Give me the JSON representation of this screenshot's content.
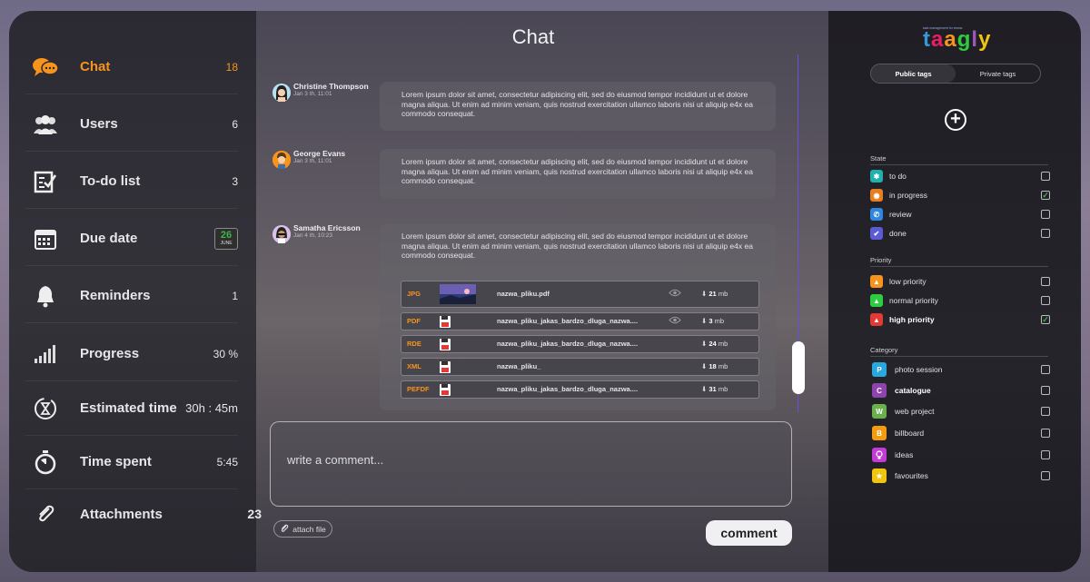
{
  "sidebar": {
    "items": [
      {
        "label": "Chat",
        "value": "18",
        "icon": "chat-bubbles-icon"
      },
      {
        "label": "Users",
        "value": "6",
        "icon": "users-icon"
      },
      {
        "label": "To-do list",
        "value": "3",
        "icon": "checklist-icon"
      },
      {
        "label": "Due date",
        "value": "",
        "icon": "calendar-icon"
      },
      {
        "label": "Reminders",
        "value": "1",
        "icon": "bell-icon"
      },
      {
        "label": "Progress",
        "value": "30 %",
        "icon": "bars-icon"
      },
      {
        "label": "Estimated time",
        "value": "30h : 45m",
        "icon": "hourglass-icon"
      },
      {
        "label": "Time spent",
        "value": "5:45",
        "icon": "stopwatch-icon"
      },
      {
        "label": "Attachments",
        "value": "23",
        "icon": "paperclip-icon"
      }
    ],
    "due_day": "26",
    "due_month": "JUNE"
  },
  "chat": {
    "title": "Chat",
    "messages": [
      {
        "author": "Christine Thompson",
        "date": "Jan 3 th, 11:01",
        "text": "Lorem ipsum dolor sit amet, consectetur adipiscing elit, sed do eiusmod tempor  incididunt ut et  dolore magna aliqua. Ut enim ad minim veniam, quis nostrud exercitation ullamco laboris nisi ut aliquip e4x ea commodo consequat."
      },
      {
        "author": "George Evans",
        "date": "Jan 3 th, 11:01",
        "text": "Lorem ipsum dolor sit amet, consectetur adipiscing elit, sed do eiusmod tempor  incididunt ut et  dolore magna aliqua. Ut enim ad minim veniam, quis nostrud exercitation ullamco laboris nisi ut aliquip e4x ea commodo consequat."
      },
      {
        "author": "Samatha Ericsson",
        "date": "Jan 4 th, 10:23",
        "text": "Lorem ipsum dolor sit amet, consectetur adipiscing elit, sed do eiusmod tempor  incididunt ut et  dolore magna aliqua. Ut enim ad minim veniam, quis nostrud exercitation ullamco laboris nisi ut aliquip e4x ea commodo consequat."
      }
    ],
    "files": [
      {
        "ext": "JPG",
        "name": "nazwa_pliku.pdf",
        "size": "21",
        "unit": "mb",
        "preview": true
      },
      {
        "ext": "PDF",
        "name": "nazwa_pliku_jakas_bardzo_dluga_nazwa....",
        "size": "3",
        "unit": "mb",
        "preview": true
      },
      {
        "ext": "RDE",
        "name": "nazwa_pliku_jakas_bardzo_dluga_nazwa....",
        "size": "24",
        "unit": "mb",
        "preview": false
      },
      {
        "ext": "XML",
        "name": "nazwa_pliku_",
        "size": "18",
        "unit": "mb",
        "preview": false
      },
      {
        "ext": "PEFDF",
        "name": "nazwa_pliku_jakas_bardzo_dluga_nazwa....",
        "size": "31",
        "unit": "mb",
        "preview": false
      }
    ],
    "comment_placeholder": "write a comment...",
    "attach_label": "attach file",
    "comment_button": "comment"
  },
  "right": {
    "logo": "taagly",
    "logo_tagline": "task management for teams",
    "tabs": [
      "Public tags",
      "Private tags"
    ],
    "state_title": "State",
    "state": [
      {
        "label": "to do",
        "checked": false,
        "color": "#20b2aa"
      },
      {
        "label": "in progress",
        "checked": true,
        "color": "#e67e22"
      },
      {
        "label": "review",
        "checked": false,
        "color": "#2e86de"
      },
      {
        "label": "done",
        "checked": false,
        "color": "#5b5bd6"
      }
    ],
    "priority_title": "Priority",
    "priority": [
      {
        "label": "low priority",
        "checked": false,
        "color": "#f7941d"
      },
      {
        "label": "normal priority",
        "checked": false,
        "color": "#2ecc40"
      },
      {
        "label": "high priority",
        "checked": true,
        "color": "#e53935"
      }
    ],
    "category_title": "Category",
    "category": [
      {
        "label": "photo session",
        "letter": "P",
        "checked": false,
        "color": "#29a8e0"
      },
      {
        "label": "catalogue",
        "letter": "C",
        "checked": false,
        "color": "#8e44ad"
      },
      {
        "label": "web project",
        "letter": "W",
        "checked": false,
        "color": "#6ab04c"
      },
      {
        "label": "billboard",
        "letter": "B",
        "checked": false,
        "color": "#f39c12"
      },
      {
        "label": "ideas",
        "letter": "",
        "checked": false,
        "color": "#c23bd6"
      },
      {
        "label": "favourites",
        "letter": "★",
        "checked": false,
        "color": "#f1c40f"
      }
    ]
  },
  "colors": {
    "accent": "#f7941d",
    "check": "#3bb54a",
    "scroll": "#6b4fd8"
  }
}
